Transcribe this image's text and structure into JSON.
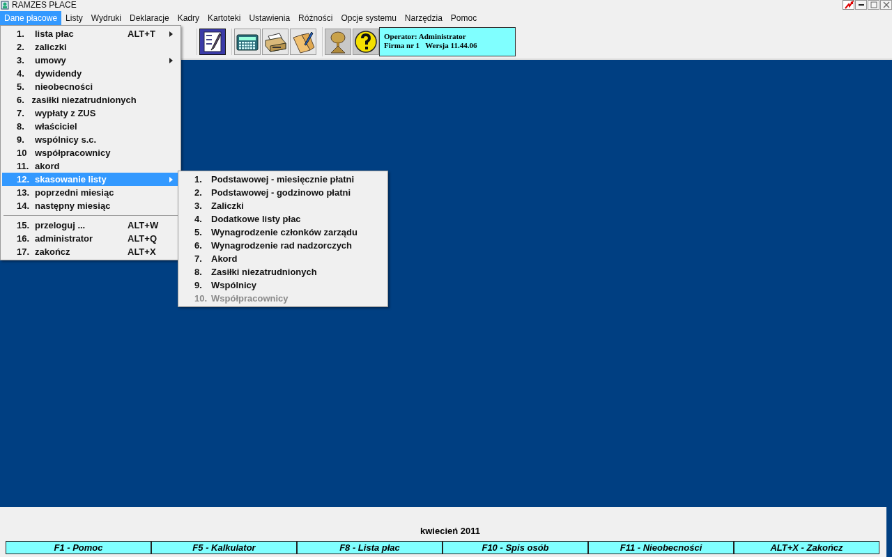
{
  "window": {
    "title": "RAMZES PŁACE"
  },
  "menubar": [
    {
      "label": "Dane płacowe",
      "selected": true
    },
    {
      "label": "Listy",
      "selected": false
    },
    {
      "label": "Wydruki",
      "selected": false
    },
    {
      "label": "Deklaracje",
      "selected": false
    },
    {
      "label": "Kadry",
      "selected": false
    },
    {
      "label": "Kartoteki",
      "selected": false
    },
    {
      "label": "Ustawienia",
      "selected": false
    },
    {
      "label": "Różności",
      "selected": false
    },
    {
      "label": "Opcje systemu",
      "selected": false
    },
    {
      "label": "Narzędzia",
      "selected": false
    },
    {
      "label": "Pomoc",
      "selected": false
    }
  ],
  "toolbar": {
    "buttons": [
      {
        "kind": "form"
      },
      {
        "kind": "calculator"
      },
      {
        "kind": "printer"
      },
      {
        "kind": "book"
      },
      {
        "kind": "antenna"
      },
      {
        "kind": "help"
      }
    ],
    "info": [
      "Operator: Administrator",
      "Firma nr 1   Wersja 11.44.06"
    ]
  },
  "menu": [
    {
      "number": "1.",
      "label": "lista płac",
      "shortcut": "ALT+T",
      "submenu": true,
      "selected": false
    },
    {
      "number": "2.",
      "label": "zaliczki",
      "submenu": false,
      "selected": false
    },
    {
      "number": "3.",
      "label": "umowy",
      "submenu": true,
      "selected": false
    },
    {
      "number": "4.",
      "label": "dywidendy",
      "submenu": false,
      "selected": false
    },
    {
      "number": "5.",
      "label": "nieobecności",
      "submenu": false,
      "selected": false
    },
    {
      "number": "6.",
      "label": "zasiłki niezatrudnionych",
      "submenu": false,
      "selected": false
    },
    {
      "number": "7.",
      "label": "wypłaty z ZUS",
      "submenu": false,
      "selected": false
    },
    {
      "number": "8.",
      "label": "właściciel",
      "submenu": false,
      "selected": false
    },
    {
      "number": "9.",
      "label": "wspólnicy s.c.",
      "submenu": false,
      "selected": false
    },
    {
      "number": "10",
      "label": "współpracownicy",
      "submenu": false,
      "selected": false
    },
    {
      "number": "11.",
      "label": "akord",
      "submenu": false,
      "selected": false
    },
    {
      "number": "12.",
      "label": "skasowanie listy",
      "submenu": true,
      "selected": true
    },
    {
      "number": "13.",
      "label": "poprzedni miesiąc",
      "submenu": false,
      "selected": false
    },
    {
      "number": "14.",
      "label": "następny miesiąc",
      "submenu": false,
      "selected": false
    },
    {
      "kind": "separator"
    },
    {
      "number": "15.",
      "label": "przeloguj ...",
      "shortcut": "ALT+W",
      "submenu": false,
      "selected": false
    },
    {
      "number": "16.",
      "label": "administrator",
      "shortcut": "ALT+Q",
      "submenu": false,
      "selected": false
    },
    {
      "number": "17.",
      "label": "zakończ",
      "shortcut": "ALT+X",
      "submenu": false,
      "selected": false
    }
  ],
  "submenu": [
    {
      "number": "1.",
      "label": "Podstawowej - miesięcznie płatni",
      "disabled": false
    },
    {
      "number": "2.",
      "label": "Podstawowej - godzinowo płatni",
      "disabled": false
    },
    {
      "number": "3.",
      "label": "Zaliczki",
      "disabled": false
    },
    {
      "number": "4.",
      "label": "Dodatkowe listy płac",
      "disabled": false
    },
    {
      "number": "5.",
      "label": "Wynagrodzenie członków zarządu",
      "disabled": false
    },
    {
      "number": "6.",
      "label": "Wynagrodzenie rad nadzorczych",
      "disabled": false
    },
    {
      "number": "7.",
      "label": "Akord",
      "disabled": false
    },
    {
      "number": "8.",
      "label": "Zasiłki niezatrudnionych",
      "disabled": false
    },
    {
      "number": "9.",
      "label": "Wspólnicy",
      "disabled": false
    },
    {
      "number": "10.",
      "label": "Współpracownicy",
      "disabled": true
    }
  ],
  "status_bar": {
    "period": "kwiecień 2011",
    "keys": [
      "F1 - Pomoc",
      "F5 - Kalkulator",
      "F8 - Lista płac",
      "F10 - Spis osób",
      "F11 - Nieobecności",
      "ALT+X - Zakończ"
    ]
  }
}
